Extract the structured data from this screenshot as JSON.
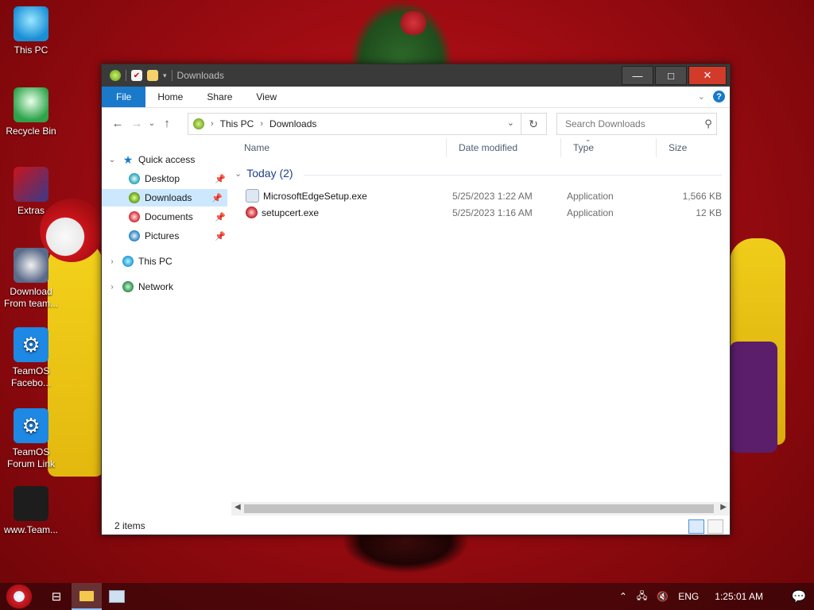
{
  "desktop": {
    "icons": [
      {
        "label": "This PC",
        "icon": "this-pc-icon"
      },
      {
        "label": "Recycle Bin",
        "icon": "recycle-bin-icon"
      },
      {
        "label": "Extras",
        "icon": "extras-icon"
      },
      {
        "label": "Download From team...",
        "icon": "download-icon"
      },
      {
        "label": "TeamOS Facebo...",
        "icon": "gear-icon"
      },
      {
        "label": "TeamOS Forum Link",
        "icon": "gear-icon"
      },
      {
        "label": "www.Team...",
        "icon": "file-icon"
      }
    ]
  },
  "window": {
    "title": "Downloads",
    "controls": {
      "minimize": "—",
      "maximize": "□",
      "close": "✕"
    },
    "ribbon_tabs": [
      "File",
      "Home",
      "Share",
      "View"
    ],
    "help": "?",
    "address": {
      "crumbs": [
        "This PC",
        "Downloads"
      ]
    },
    "search": {
      "placeholder": "Search Downloads"
    },
    "nav": {
      "quick_access": "Quick access",
      "items": [
        "Desktop",
        "Downloads",
        "Documents",
        "Pictures"
      ],
      "this_pc": "This PC",
      "network": "Network"
    },
    "columns": [
      "Name",
      "Date modified",
      "Type",
      "Size"
    ],
    "group": "Today (2)",
    "files": [
      {
        "name": "MicrosoftEdgeSetup.exe",
        "date": "5/25/2023 1:22 AM",
        "type": "Application",
        "size": "1,566 KB"
      },
      {
        "name": "setupcert.exe",
        "date": "5/25/2023 1:16 AM",
        "type": "Application",
        "size": "12 KB"
      }
    ],
    "status": "2 items"
  },
  "taskbar": {
    "language": "ENG",
    "clock": "1:25:01 AM"
  },
  "colors": {
    "accent": "#1979ca",
    "selection": "#cce8ff",
    "close": "#d23a2a",
    "titlebar": "#3a3a3a"
  }
}
